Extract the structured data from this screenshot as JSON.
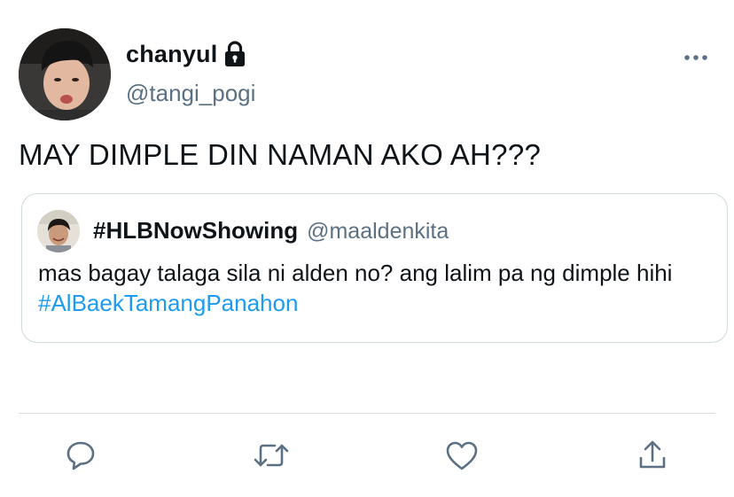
{
  "author": {
    "display_name": "chanyul",
    "handle": "@tangi_pogi",
    "protected_icon": "lock-icon",
    "avatar": "profile-photo"
  },
  "more_icon": "more-horizontal-icon",
  "tweet": {
    "text": "MAY DIMPLE DIN NAMAN AKO AH???"
  },
  "quoted_tweet": {
    "display_name": "#HLBNowShowing",
    "handle": "@maaldenkita",
    "avatar": "profile-photo",
    "text": "mas bagay talaga sila ni alden no? ang lalim pa ng dimple hihi ",
    "hashtag": "#AlBaekTamangPanahon"
  },
  "actions": [
    {
      "icon": "reply-icon"
    },
    {
      "icon": "retweet-icon"
    },
    {
      "icon": "like-icon"
    },
    {
      "icon": "share-icon"
    }
  ],
  "colors": {
    "text": "#0f1419",
    "secondary": "#5b7083",
    "link": "#1d9bf0",
    "border": "#cfd9de"
  }
}
